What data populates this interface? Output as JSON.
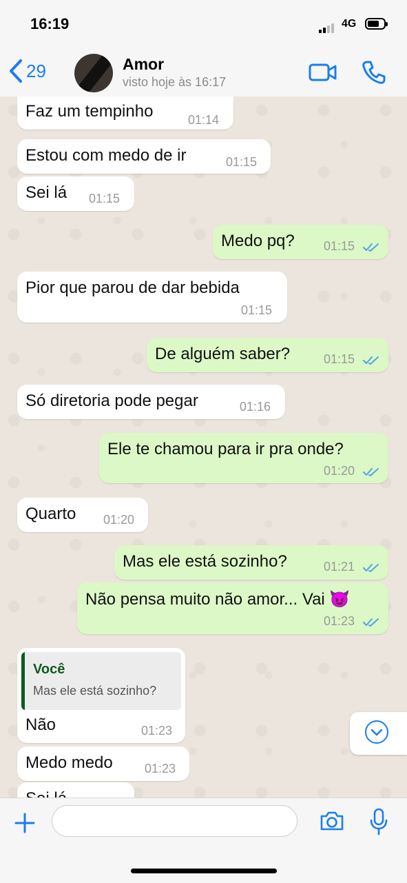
{
  "status_bar": {
    "time": "16:19",
    "network": "4G"
  },
  "header": {
    "back_count": "29",
    "contact_name": "Amor",
    "contact_status": "visto hoje às 16:17"
  },
  "messages": [
    {
      "dir": "in",
      "text": "Faz um tempinho",
      "time": "01:14"
    },
    {
      "dir": "in",
      "text": "Estou com medo de ir",
      "time": "01:15"
    },
    {
      "dir": "in",
      "text": "Sei lá",
      "time": "01:15"
    },
    {
      "dir": "out",
      "text": "Medo pq?",
      "time": "01:15",
      "read": true
    },
    {
      "dir": "in",
      "text": "Pior que parou de dar bebida",
      "time": "01:15"
    },
    {
      "dir": "out",
      "text": "De alguém saber?",
      "time": "01:15",
      "read": true
    },
    {
      "dir": "in",
      "text": "Só diretoria pode pegar",
      "time": "01:16"
    },
    {
      "dir": "out",
      "text": "Ele te chamou para ir pra onde?",
      "time": "01:20",
      "read": true
    },
    {
      "dir": "in",
      "text": "Quarto",
      "time": "01:20"
    },
    {
      "dir": "out",
      "text": "Mas ele está sozinho?",
      "time": "01:21",
      "read": true
    },
    {
      "dir": "out",
      "text": "Não pensa muito não amor... Vai 😈",
      "time": "01:23",
      "read": true
    },
    {
      "dir": "in",
      "text": "Não",
      "time": "01:23",
      "reply": {
        "author": "Você",
        "text": "Mas ele está sozinho?"
      }
    },
    {
      "dir": "in",
      "text": "Medo medo",
      "time": "01:23"
    },
    {
      "dir": "in",
      "text": "Sei lá",
      "time": ""
    }
  ],
  "input": {
    "placeholder": ""
  },
  "colors": {
    "accent": "#1a7cf3",
    "outgoing_bubble": "#dcf8c6",
    "incoming_bubble": "#ffffff",
    "chat_background": "#ece5dd",
    "read_ticks": "#4fa3e6",
    "reply_author": "#0f5a1d"
  },
  "icons": [
    "back-chevron-icon",
    "video-camera-icon",
    "phone-icon",
    "chevron-down-icon",
    "plus-icon",
    "camera-icon",
    "microphone-icon"
  ]
}
